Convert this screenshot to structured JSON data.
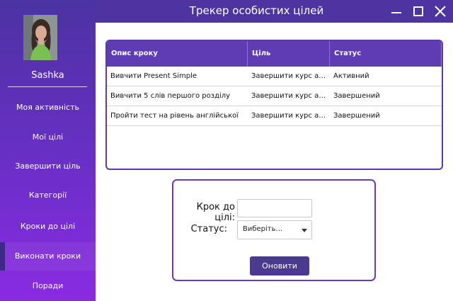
{
  "window": {
    "title": "Трекер особистих цілей"
  },
  "user": {
    "name": "Sashka"
  },
  "nav": {
    "items": [
      {
        "label": "Моя активність"
      },
      {
        "label": "Мої цілі"
      },
      {
        "label": "Завершити ціль"
      },
      {
        "label": "Категорії"
      },
      {
        "label": "Кроки до цілі"
      },
      {
        "label": "Виконати кроки"
      },
      {
        "label": "Поради"
      }
    ],
    "active": "Виконати кроки"
  },
  "table": {
    "columns": [
      "Опис кроку",
      "Ціль",
      "Статус"
    ],
    "rows": [
      [
        "Вивчити Present Simple",
        "Завершити курс англ...",
        "Активний"
      ],
      [
        "Вивчити 5 слів першого розділу",
        "Завершити курс англ...",
        "Завершений"
      ],
      [
        "Пройти тест на рівень англійської",
        "Завершити курс англ...",
        "Завершений"
      ]
    ]
  },
  "form": {
    "step_label": "Крок до цілі:",
    "step_value": "",
    "status_label": "Статус:",
    "status_value": "Виберіть...",
    "submit_label": "Оновити"
  },
  "colors": {
    "title_bar": "#4d34a0",
    "sidebar_top": "#4b33a1",
    "sidebar_bottom": "#8a2be2",
    "table_header": "#5f3bb4",
    "button": "#4b3a8f"
  },
  "icons": [
    "minimize-icon",
    "maximize-icon",
    "close-icon",
    "chevron-down-icon",
    "column-menu-icon"
  ]
}
